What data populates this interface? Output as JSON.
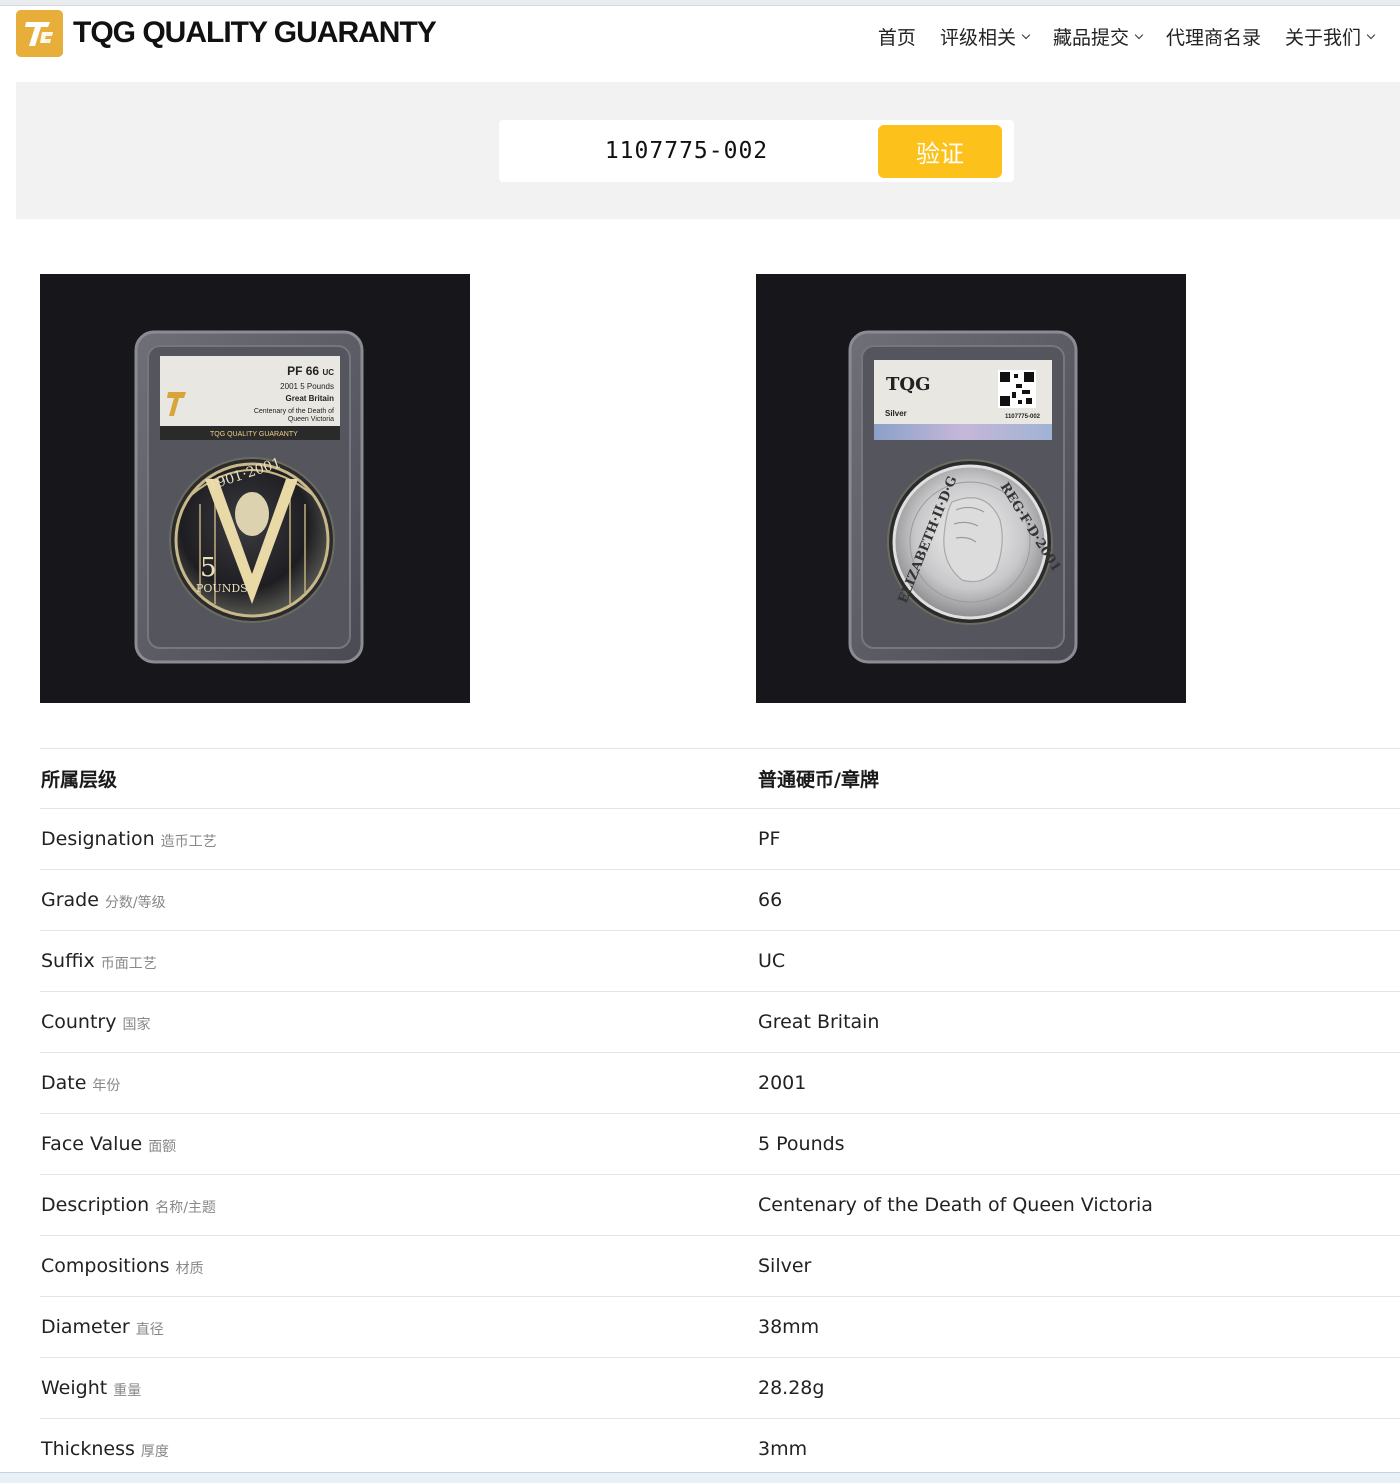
{
  "header": {
    "brand": "TQG QUALITY GUARANTY",
    "nav": [
      {
        "label": "首页",
        "has_dropdown": false
      },
      {
        "label": "评级相关",
        "has_dropdown": true
      },
      {
        "label": "藏品提交",
        "has_dropdown": true
      },
      {
        "label": "代理商名录",
        "has_dropdown": false
      },
      {
        "label": "关于我们",
        "has_dropdown": true
      }
    ]
  },
  "search": {
    "value": "1107775-002",
    "button_label": "验证"
  },
  "photos": {
    "front_label": {
      "grade": "PF 66",
      "suffix": "UC",
      "line1": "2001   5 Pounds",
      "line2": "Great Britain",
      "line3": "Centenary of the Death of",
      "line4": "Queen Victoria",
      "footer": "TQG QUALITY GUARANTY",
      "coin_years": "1901·2001",
      "coin_value": "5",
      "coin_unit": "POUNDS"
    },
    "back_label": {
      "logo": "TQG",
      "material": "Silver",
      "cert": "1107775-002",
      "coin_legend_left": "ELIZABETH·II·D·G",
      "coin_legend_right": "REG·F·D·2001"
    }
  },
  "details": {
    "header": {
      "label": "所属层级",
      "value": "普通硬币/章牌"
    },
    "rows": [
      {
        "label": "Designation",
        "zh": "造币工艺",
        "value": "PF"
      },
      {
        "label": "Grade",
        "zh": "分数/等级",
        "value": "66"
      },
      {
        "label": "Suffix",
        "zh": "币面工艺",
        "value": "UC"
      },
      {
        "label": "Country",
        "zh": "国家",
        "value": "Great Britain"
      },
      {
        "label": "Date",
        "zh": "年份",
        "value": "2001"
      },
      {
        "label": "Face Value",
        "zh": "面额",
        "value": "5 Pounds"
      },
      {
        "label": "Description",
        "zh": "名称/主题",
        "value": "Centenary of the Death of Queen Victoria"
      },
      {
        "label": "Compositions",
        "zh": "材质",
        "value": "Silver"
      },
      {
        "label": "Diameter",
        "zh": "直径",
        "value": "38mm"
      },
      {
        "label": "Weight",
        "zh": "重量",
        "value": "28.28g"
      },
      {
        "label": "Thickness",
        "zh": "厚度",
        "value": "3mm"
      }
    ]
  },
  "colors": {
    "accent": "#fcc11a",
    "logo": "#e8ae3a",
    "photo_bg": "#17161a"
  }
}
